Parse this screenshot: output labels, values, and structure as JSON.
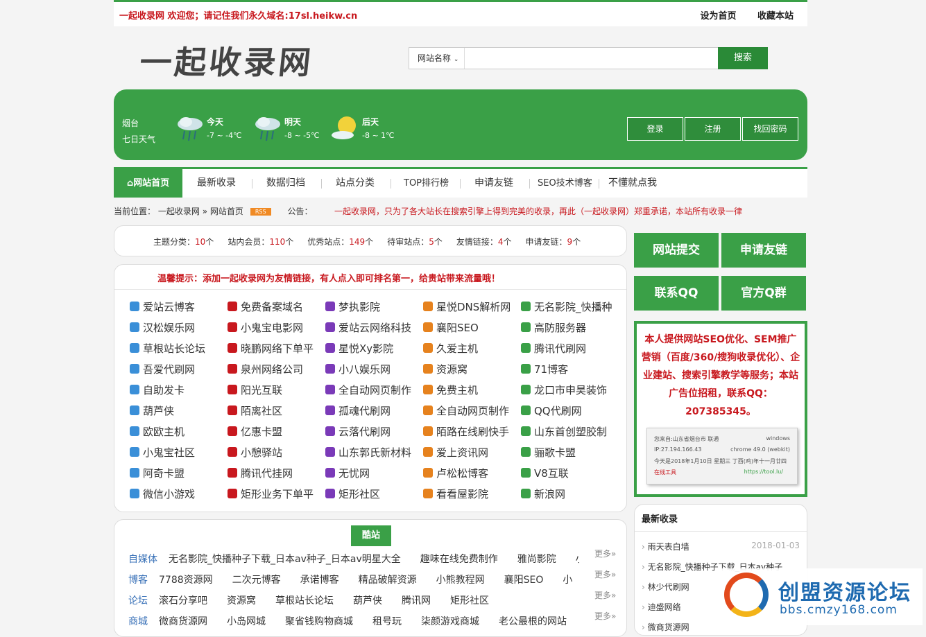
{
  "topbar": {
    "left": "一起收录网 欢迎您；请记住我们永久域名:17sl.heikw.cn",
    "set_home": "设为首页",
    "favorite": "收藏本站"
  },
  "logo": "一起收录网",
  "search": {
    "select": "网站名称",
    "button": "搜索"
  },
  "weather": {
    "city": "烟台",
    "week": "七日天气",
    "days": [
      {
        "label": "今天",
        "temp": "-7 ~ -4℃"
      },
      {
        "label": "明天",
        "temp": "-8 ~ -5℃"
      },
      {
        "label": "后天",
        "temp": "-8 ~ 1℃"
      }
    ],
    "login": "登录",
    "register": "注册",
    "recover": "找回密码"
  },
  "nav": {
    "home": "网站首页",
    "items": [
      "最新收录",
      "数据归档",
      "站点分类",
      "TOP排行榜",
      "申请友链",
      "SEO技术博客",
      "不懂就点我"
    ]
  },
  "crumb": {
    "label": "当前位置：",
    "site": "一起收录网",
    "sep": "»",
    "page": "网站首页",
    "rss": "RSS",
    "notice_label": "公告：",
    "notice": "一起收录网，只为了各大站长在搜索引擎上得到完美的收录，再此（一起收录网）郑重承诺，本站所有收录一律"
  },
  "stats": [
    {
      "label": "主题分类：",
      "num": "10",
      "unit": "个"
    },
    {
      "label": "站内会员：",
      "num": "110",
      "unit": "个"
    },
    {
      "label": "优秀站点：",
      "num": "149",
      "unit": "个"
    },
    {
      "label": "待审站点：",
      "num": "5",
      "unit": "个"
    },
    {
      "label": "友情链接：",
      "num": "4",
      "unit": "个"
    },
    {
      "label": "申请友链：",
      "num": "9",
      "unit": "个"
    }
  ],
  "tip": "温馨提示：添加一起收录网为友情链接，有人点入即可排名第一，给贵站带来流量哦！",
  "links": [
    "爱站云博客",
    "免费备案域名",
    "梦执影院",
    "星悦DNS解析网",
    "无名影院_快播种",
    "汉松娱乐网",
    "小鬼宝电影网",
    "爱站云网络科技",
    "襄阳SEO",
    "高防服务器",
    "草根站长论坛",
    "晓鹏网络下单平",
    "星悦Xy影院",
    "久爱主机",
    "腾讯代刷网",
    "吾爱代刷网",
    "泉州网络公司",
    "小八娱乐网",
    "资源窝",
    "71博客",
    "自助发卡",
    "阳光互联",
    "全自动网页制作",
    "免费主机",
    "龙口市申昊装饰",
    "葫芦侠",
    "陌离社区",
    "孤魂代刷网",
    "全自动网页制作",
    "QQ代刷网",
    "欧欧主机",
    "亿惠卡盟",
    "云落代刷网",
    "陌路在线刷快手",
    "山东首创塑胶制",
    "小鬼宝社区",
    "小憩驿站",
    "山东郭氏新材料",
    "爱上资讯网",
    "骊歌卡盟",
    "阿奇卡盟",
    "腾讯代挂网",
    "无忧网",
    "卢松松博客",
    "V8互联",
    "微信小游戏",
    "矩形业务下单平",
    "矩形社区",
    "看看屋影院",
    "新浪网"
  ],
  "cool": {
    "tag": "酷站",
    "more": "更多»",
    "rows": [
      {
        "cat": "自媒体",
        "sites": [
          "无名影院_快播种子下载_日本av种子_日本av明星大全",
          "趣味在线免费制作",
          "雅尚影院",
          "小"
        ]
      },
      {
        "cat": "博客",
        "sites": [
          "7788资源网",
          "二次元博客",
          "承诺博客",
          "精品破解资源",
          "小熊教程网",
          "襄阳SEO",
          "小"
        ]
      },
      {
        "cat": "论坛",
        "sites": [
          "滚石分享吧",
          "资源窝",
          "草根站长论坛",
          "葫芦侠",
          "腾讯网",
          "矩形社区"
        ]
      },
      {
        "cat": "商城",
        "sites": [
          "微商货源网",
          "小岛网城",
          "聚省钱购物商城",
          "租号玩",
          "柒颜游戏商城",
          "老公最根的网站"
        ]
      }
    ]
  },
  "right": {
    "submit": "网站提交",
    "apply": "申请友链",
    "qq": "联系QQ",
    "group": "官方Q群",
    "ad": "本人提供网站SEO优化、SEM推广营销（百度/360/搜狗收录优化）、企业建站、搜索引擎教学等服务；本站广告位招租，联系QQ：207385345。",
    "shot": {
      "from": "您来自:山东省烟台市 联通",
      "os": "windows",
      "ip": "IP:27.194.166.43",
      "browser": "chrome 49.0 (webkit)",
      "date": "今天是2018年1月10日 星期三 丁酉(鸡)年十一月廿四",
      "tool": "在线工具",
      "url": "https://tool.lu/"
    }
  },
  "latest": {
    "title": "最新收录",
    "items": [
      {
        "name": "雨天表白墙",
        "date": "2018-01-03"
      },
      {
        "name": "无名影院_快播种子下载_日本av种子",
        "date": ""
      },
      {
        "name": "林少代刷网",
        "date": ""
      },
      {
        "name": "迪盛网络",
        "date": ""
      },
      {
        "name": "微商货源网",
        "date": ""
      }
    ]
  },
  "watermark": {
    "title": "创盟资源论坛",
    "url": "bbs.cmzy168.com"
  },
  "colors": {
    "green": "#3aa047",
    "red": "#c8181e",
    "blue": "#3a72b8"
  }
}
